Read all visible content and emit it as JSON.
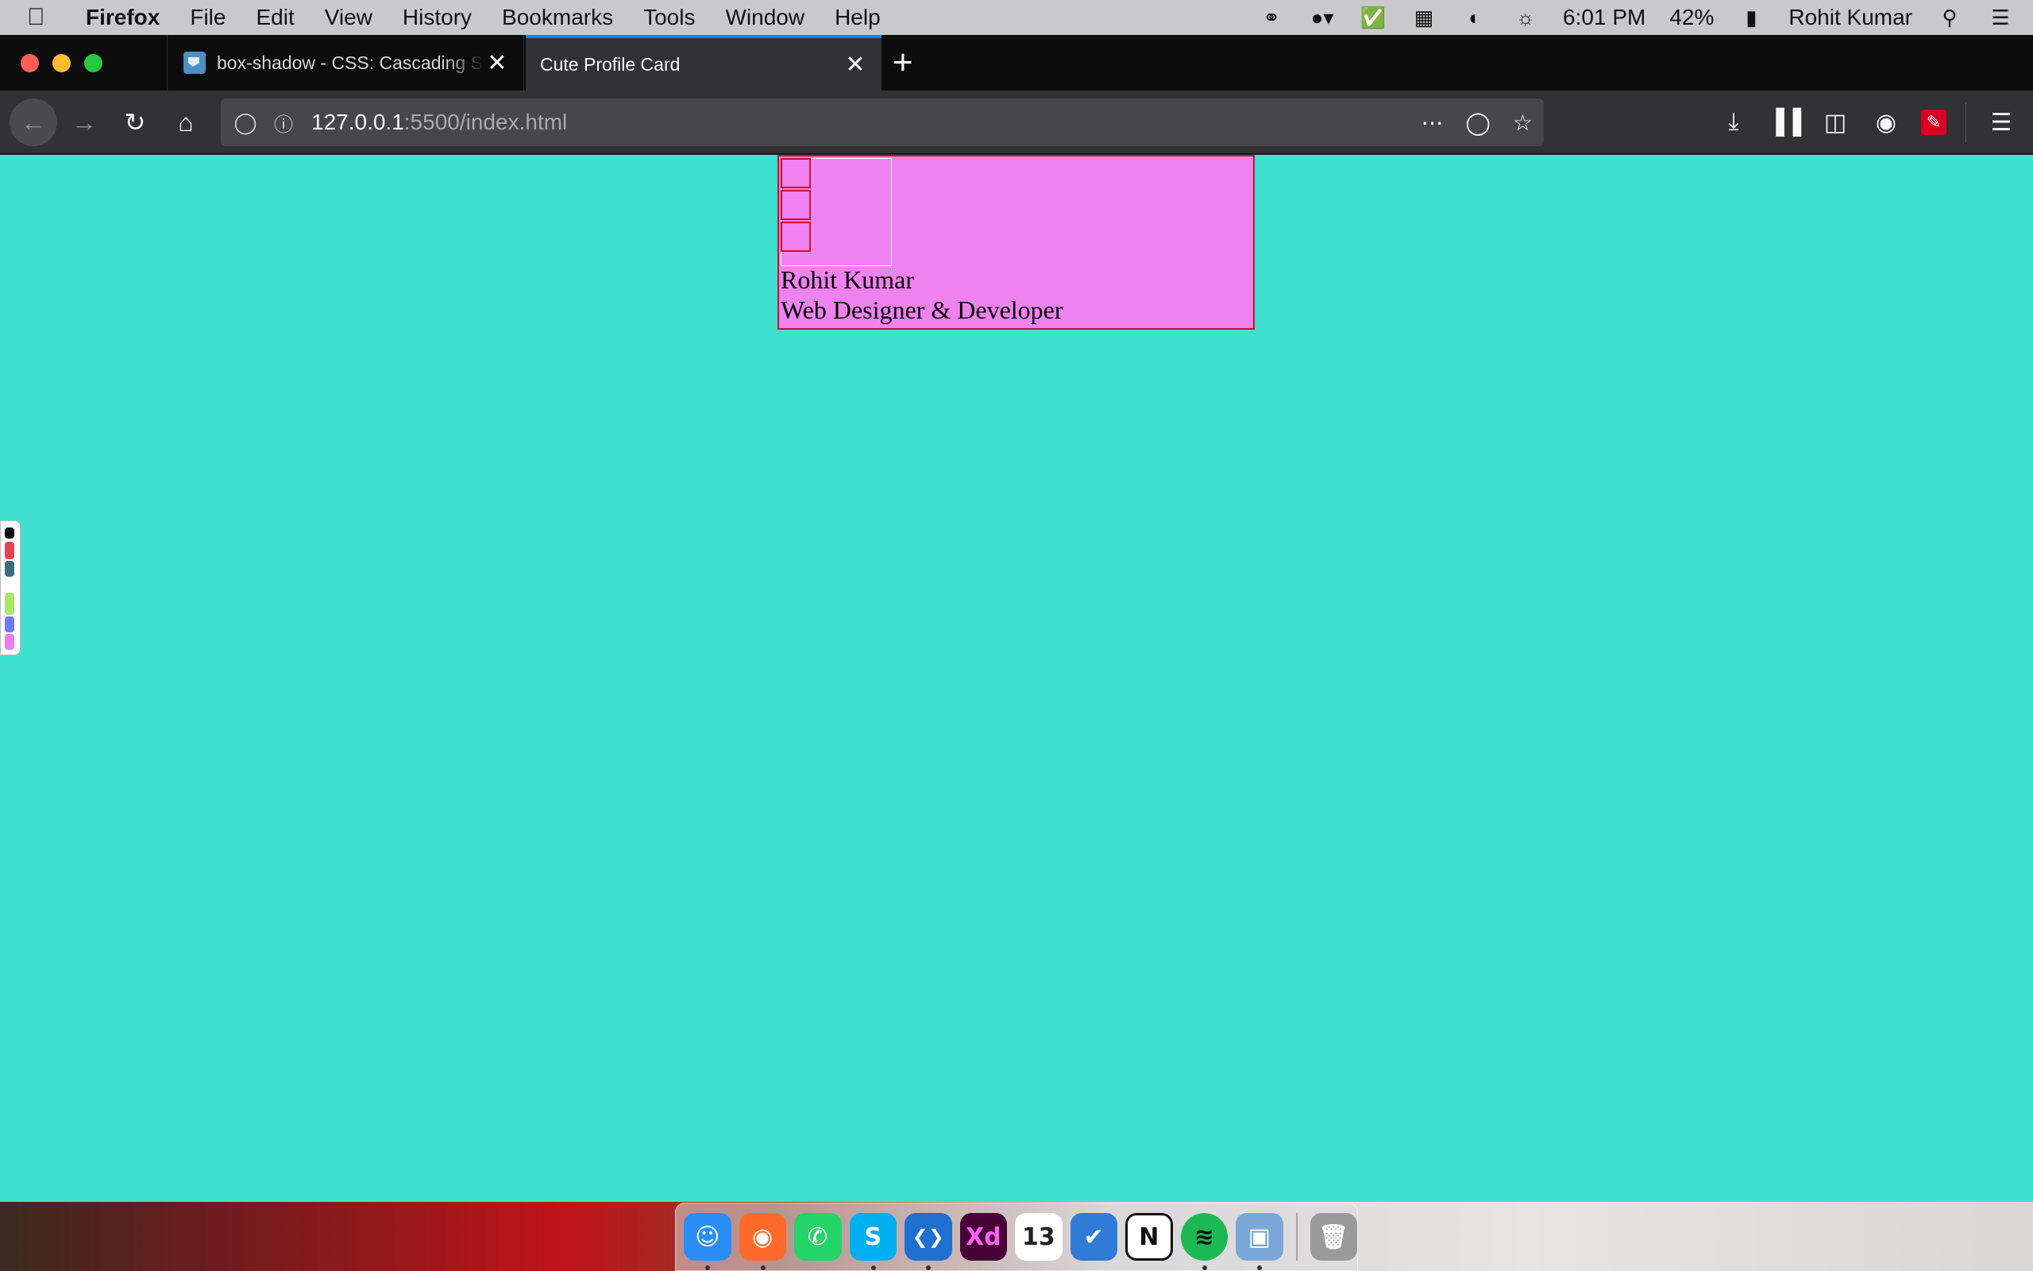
{
  "menubar": {
    "app_name": "Firefox",
    "items": [
      "File",
      "Edit",
      "View",
      "History",
      "Bookmarks",
      "Tools",
      "Window",
      "Help"
    ],
    "time": "6:01 PM",
    "battery": "42%",
    "user": "Rohit Kumar",
    "status_icons": [
      "creative-cloud-icon",
      "toggle-icon",
      "checkbox-icon",
      "layout-icon",
      "stripe-icon",
      "vpn-icon"
    ]
  },
  "tabs": [
    {
      "title": "box-shadow - CSS: Cascading Style Sheets",
      "active": false
    },
    {
      "title": "Cute Profile Card",
      "active": true
    }
  ],
  "urlbar": {
    "host": "127.0.0.1",
    "rest": ":5500/index.html"
  },
  "page": {
    "background": "#40e0d0",
    "card": {
      "background": "violet",
      "border_color": "#c8102e",
      "name": "Rohit Kumar",
      "role": "Web Designer & Developer"
    }
  },
  "dock": {
    "apps": [
      {
        "name": "Finder",
        "icon": "finder-icon",
        "color": "#2a8df5",
        "glyph": "☺",
        "running": true
      },
      {
        "name": "Firefox",
        "icon": "firefox-icon",
        "color": "#ff6a2a",
        "glyph": "◉",
        "running": true
      },
      {
        "name": "WhatsApp",
        "icon": "whatsapp-icon",
        "color": "#25d366",
        "glyph": "✆",
        "running": false
      },
      {
        "name": "Skype",
        "icon": "skype-icon",
        "color": "#00aff0",
        "glyph": "S",
        "running": true
      },
      {
        "name": "VS Code",
        "icon": "vscode-icon",
        "color": "#1f6fd1",
        "glyph": "❮❯",
        "running": true
      },
      {
        "name": "Adobe XD",
        "icon": "adobe-xd-icon",
        "color": "#470137",
        "glyph": "Xd",
        "running": false
      },
      {
        "name": "Calendar",
        "icon": "calendar-icon",
        "color": "#ffffff",
        "glyph": "13",
        "running": false
      },
      {
        "name": "Tasks",
        "icon": "tasks-icon",
        "color": "#2f7bd6",
        "glyph": "✔",
        "running": false
      },
      {
        "name": "Notion",
        "icon": "notion-icon",
        "color": "#ffffff",
        "glyph": "N",
        "running": false
      },
      {
        "name": "Spotify",
        "icon": "spotify-icon",
        "color": "#1db954",
        "glyph": "≋",
        "running": true
      },
      {
        "name": "Preview",
        "icon": "preview-icon",
        "color": "#7aa6d8",
        "glyph": "▣",
        "running": true
      }
    ],
    "trash": {
      "name": "Trash",
      "icon": "trash-icon",
      "color": "#9a9a9a",
      "glyph": "🗑"
    }
  }
}
